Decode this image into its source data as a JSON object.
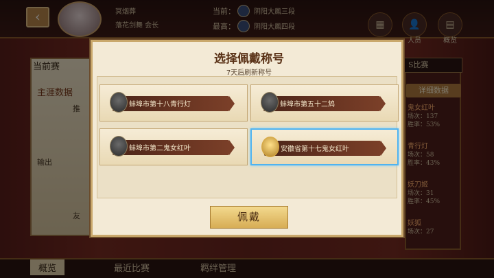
{
  "background": {
    "player": {
      "name": "冥烟葬",
      "guild": "落花剑舞 会长"
    },
    "rank": {
      "current_label": "当前：",
      "current_value": "阴阳大鳳三段",
      "max_label": "最高：",
      "max_value": "阴阳大鳳四段"
    },
    "top_icons": [
      {
        "label": "",
        "icon": "qr-code-icon"
      },
      {
        "label": "人员",
        "icon": "person-icon"
      },
      {
        "label": "概览",
        "icon": "book-icon"
      }
    ],
    "left_panel": {
      "current_season": "当前赛",
      "career_data": "主涯数据",
      "recommend": "推",
      "output": "输出",
      "fate": "友"
    },
    "right_panel": {
      "season_select": "S比赛",
      "detail_button": "详细数据",
      "characters": [
        {
          "name": "鬼女红叶",
          "line1": "场次：137",
          "line2": "胜率：53%"
        },
        {
          "name": "青行灯",
          "line1": "场次：58",
          "line2": "胜率：43%"
        },
        {
          "name": "妖刀姬",
          "line1": "场次：31",
          "line2": "胜率：45%"
        },
        {
          "name": "妖狐",
          "line1": "场次：27",
          "line2": ""
        }
      ]
    },
    "bottom_tabs": [
      "概览",
      "最近比赛",
      "羁绊管理"
    ]
  },
  "modal": {
    "title": "选择佩戴称号",
    "subtitle": "7天后刷新称号",
    "titles": [
      {
        "label": "蚌埠市第十八青行灯",
        "selected": false
      },
      {
        "label": "蚌埠市第五十二鸩",
        "selected": false
      },
      {
        "label": "蚌埠市第二鬼女红叶",
        "selected": false
      },
      {
        "label": "安徽省第十七鬼女红叶",
        "selected": true
      }
    ],
    "wear_button": "佩戴"
  },
  "colors": {
    "accent": "#c9a86c",
    "selected_border": "#4fb3f0",
    "ribbon": "#5a2b1c"
  }
}
